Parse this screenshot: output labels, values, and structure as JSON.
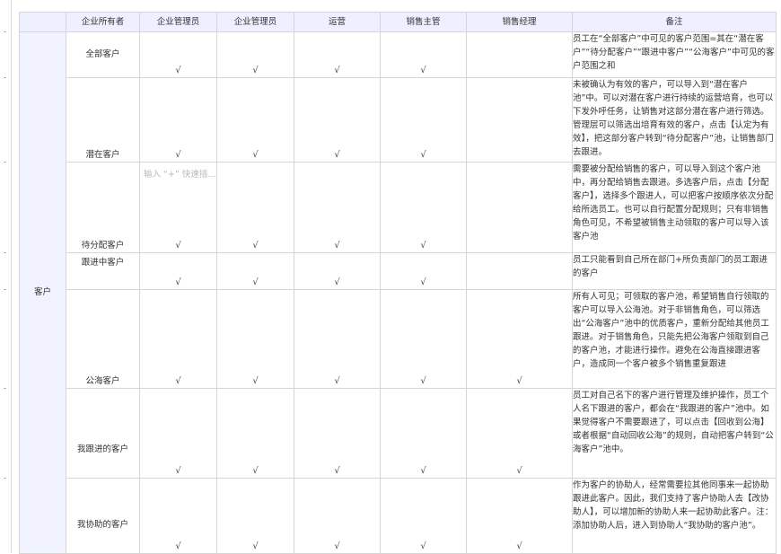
{
  "columns": [
    "",
    "企业所有者",
    "企业管理员",
    "企业管理员",
    "运营",
    "销售主管",
    "销售经理",
    "备注"
  ],
  "group_label": "客户",
  "check_mark": "√",
  "cell_placeholder": "输入 “+” 快速插...",
  "rows": [
    {
      "name": "全部客户",
      "checks": [
        "√",
        "√",
        "√",
        "√",
        "",
        ""
      ],
      "note": "员工在“全部客户”中可见的客户范围=其在“潜在客户”“待分配客户”“跟进中客户”“公海客户”中可见的客户范围之和"
    },
    {
      "name": "潜在客户",
      "checks": [
        "√",
        "√",
        "√",
        "√",
        "",
        ""
      ],
      "note": "未被确认为有效的客户，可以导入到“潜在客户池”中。可以对潜在客户进行持续的运营培育，也可以下发外呼任务，让销售对这部分潜在客户进行筛选。管理层可以筛选出培育有效的客户，点击【认定为有效】，把这部分客户转到“待分配客户”池，让销售部门去跟进。"
    },
    {
      "name": "待分配客户",
      "checks": [
        "√",
        "√",
        "√",
        "√",
        "",
        ""
      ],
      "note": "需要被分配给销售的客户，可以导入到这个客户池中，再分配给销售去跟进。多选客户后，点击【分配客户】，选择多个跟进人，可以把客户按顺序依次分配给所选员工。也可以自行配置分配规则；只有非销售角色可见，不希望被销售主动领取的客户可以导入该客户池"
    },
    {
      "name": "跟进中客户",
      "checks": [
        "√",
        "√",
        "√",
        "√",
        "",
        ""
      ],
      "note": "员工只能看到自己所在部门+所负责部门的员工跟进的客户"
    },
    {
      "name": "公海客户",
      "checks": [
        "√",
        "√",
        "√",
        "√",
        "√",
        ""
      ],
      "note": "所有人可见；可领取的客户池，希望销售自行领取的客户可以导入公海池。对于非销售角色，可以筛选出“公海客户”池中的优质客户，重新分配给其他员工跟进。对于销售角色，只能先把公海客户领取到自己的客户池，才能进行操作。避免在公海直接跟进客户，造成同一个客户被多个销售重复跟进"
    },
    {
      "name": "我跟进的客户",
      "checks": [
        "√",
        "√",
        "√",
        "√",
        "√",
        ""
      ],
      "note": "员工对自己名下的客户进行管理及维护操作，员工个人名下跟进的客户，都会在“我跟进的客户”池中。如果觉得客户不需要跟进了，可以点击【回收到公海】或者根据“自动回收公海”的规则，自动把客户转到“公海客户”池中。"
    },
    {
      "name": "我协助的客户",
      "checks": [
        "√",
        "√",
        "√",
        "√",
        "√",
        ""
      ],
      "note": "作为客户的协助人，经常需要拉其他同事来一起协助跟进此客户。因此，我们支持了客户协助人去【改协助人】，可以增加新的协助人来一起协助此客户。注：添加协助人后，进入到协助人“我协助的客户池”。"
    }
  ]
}
